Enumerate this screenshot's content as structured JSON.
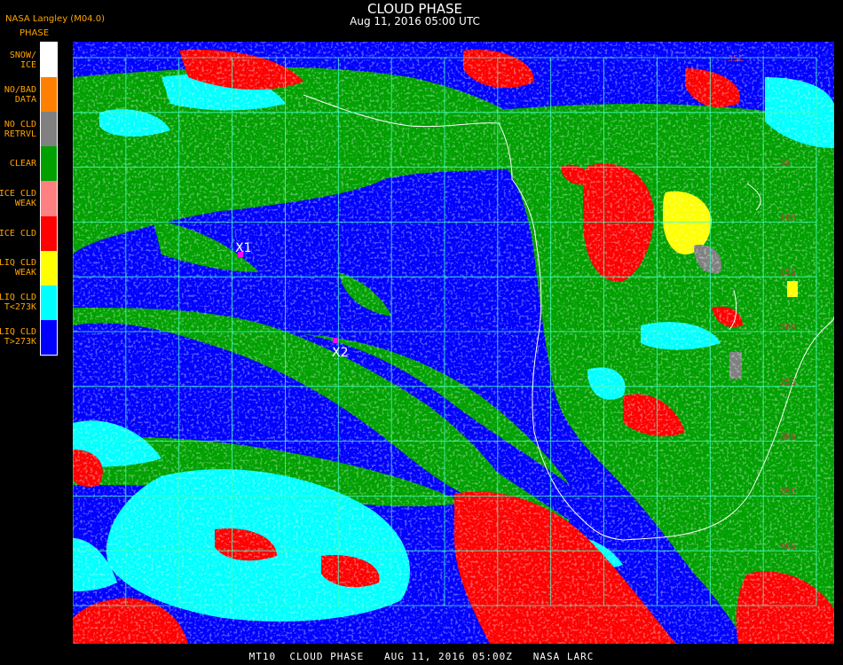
{
  "title": "CLOUD PHASE",
  "subtitle": "Aug 11, 2016 05:00 UTC",
  "org_label": "NASA Langley (M04.0)",
  "legend": {
    "title": "PHASE",
    "items": [
      {
        "label": "SNOW/\nICE",
        "color": "#ffffff"
      },
      {
        "label": "NO/BAD\nDATA",
        "color": "#ff8000"
      },
      {
        "label": "NO CLD\nRETRVL",
        "color": "#808080"
      },
      {
        "label": "CLEAR",
        "color": "#00a000"
      },
      {
        "label": "ICE CLD\nWEAK",
        "color": "#ff8080"
      },
      {
        "label": "ICE CLD",
        "color": "#ff0000"
      },
      {
        "label": "LIQ CLD\nWEAK",
        "color": "#ffff00"
      },
      {
        "label": "LIQ CLD\nT<273K",
        "color": "#00ffff"
      },
      {
        "label": "LIQ CLD\nT>273K",
        "color": "#0000ff"
      }
    ]
  },
  "markers": [
    {
      "label": "X1"
    },
    {
      "label": "X2"
    }
  ],
  "grid_labels": [
    "35E",
    "5S",
    "10S",
    "15S",
    "20S",
    "25S",
    "30S",
    "35S",
    "40S"
  ],
  "footer": "MT10  CLOUD PHASE   AUG 11, 2016 05:00Z   NASA LARC",
  "colors": {
    "liquid_warm": "#0000ff",
    "liquid_cold": "#00ffff",
    "clear": "#00a000",
    "ice": "#ff0000",
    "liquid_weak": "#ffff00",
    "no_retrieval": "#808080",
    "grid": "#40ffc0",
    "coastline": "#ffffff",
    "grid_label": "#c04040",
    "marker": "#ff00ff"
  }
}
